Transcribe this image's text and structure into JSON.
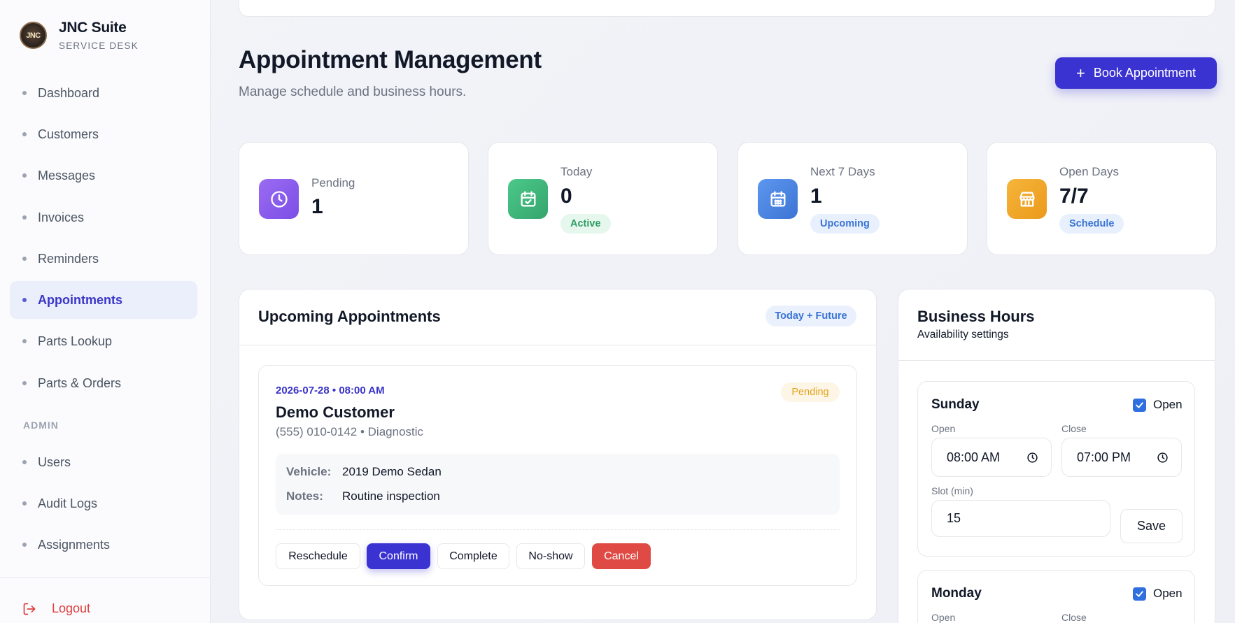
{
  "sidebar": {
    "brand_name": "JNC Suite",
    "brand_sub": "SERVICE DESK",
    "logo_text": "JNC",
    "items": [
      {
        "label": "Dashboard"
      },
      {
        "label": "Customers"
      },
      {
        "label": "Messages"
      },
      {
        "label": "Invoices"
      },
      {
        "label": "Reminders"
      },
      {
        "label": "Appointments",
        "active": true
      },
      {
        "label": "Parts Lookup"
      },
      {
        "label": "Parts & Orders"
      }
    ],
    "admin_label": "ADMIN",
    "admin_items": [
      {
        "label": "Users"
      },
      {
        "label": "Audit Logs"
      },
      {
        "label": "Assignments"
      }
    ],
    "logout_label": "Logout"
  },
  "header": {
    "title": "Appointment Management",
    "subtitle": "Manage schedule and business hours.",
    "book_button": "Book Appointment"
  },
  "stats": [
    {
      "label": "Pending",
      "value": "1",
      "chip": "",
      "icon": "clock-icon",
      "color": "#8b5cf6"
    },
    {
      "label": "Today",
      "value": "0",
      "chip": "Active",
      "icon": "calendar-check-icon",
      "color": "#3fb87a"
    },
    {
      "label": "Next 7 Days",
      "value": "1",
      "chip": "Upcoming",
      "icon": "calendar-icon",
      "color": "#4a86e8"
    },
    {
      "label": "Open Days",
      "value": "7/7",
      "chip": "Schedule",
      "icon": "store-icon",
      "color": "#f2a72c"
    }
  ],
  "upcoming": {
    "title": "Upcoming Appointments",
    "tag": "Today + Future",
    "appointment": {
      "when": "2026-07-28 • 08:00 AM",
      "name": "Demo Customer",
      "meta": "(555) 010-0142 • Diagnostic",
      "status": "Pending",
      "vehicle_label": "Vehicle:",
      "vehicle": "2019 Demo Sedan",
      "notes_label": "Notes:",
      "notes": "Routine inspection",
      "actions": {
        "reschedule": "Reschedule",
        "confirm": "Confirm",
        "complete": "Complete",
        "noshow": "No-show",
        "cancel": "Cancel"
      }
    }
  },
  "business_hours": {
    "title": "Business Hours",
    "subtitle": "Availability settings",
    "days": [
      {
        "name": "Sunday",
        "open_label": "Open",
        "checked": true,
        "open_field_label": "Open",
        "close_field_label": "Close",
        "open_time": "08:00 AM",
        "close_time": "07:00 PM",
        "slot_label": "Slot (min)",
        "slot": "15",
        "save": "Save"
      },
      {
        "name": "Monday",
        "open_label": "Open",
        "checked": true,
        "open_field_label": "Open",
        "close_field_label": "Close"
      }
    ]
  }
}
